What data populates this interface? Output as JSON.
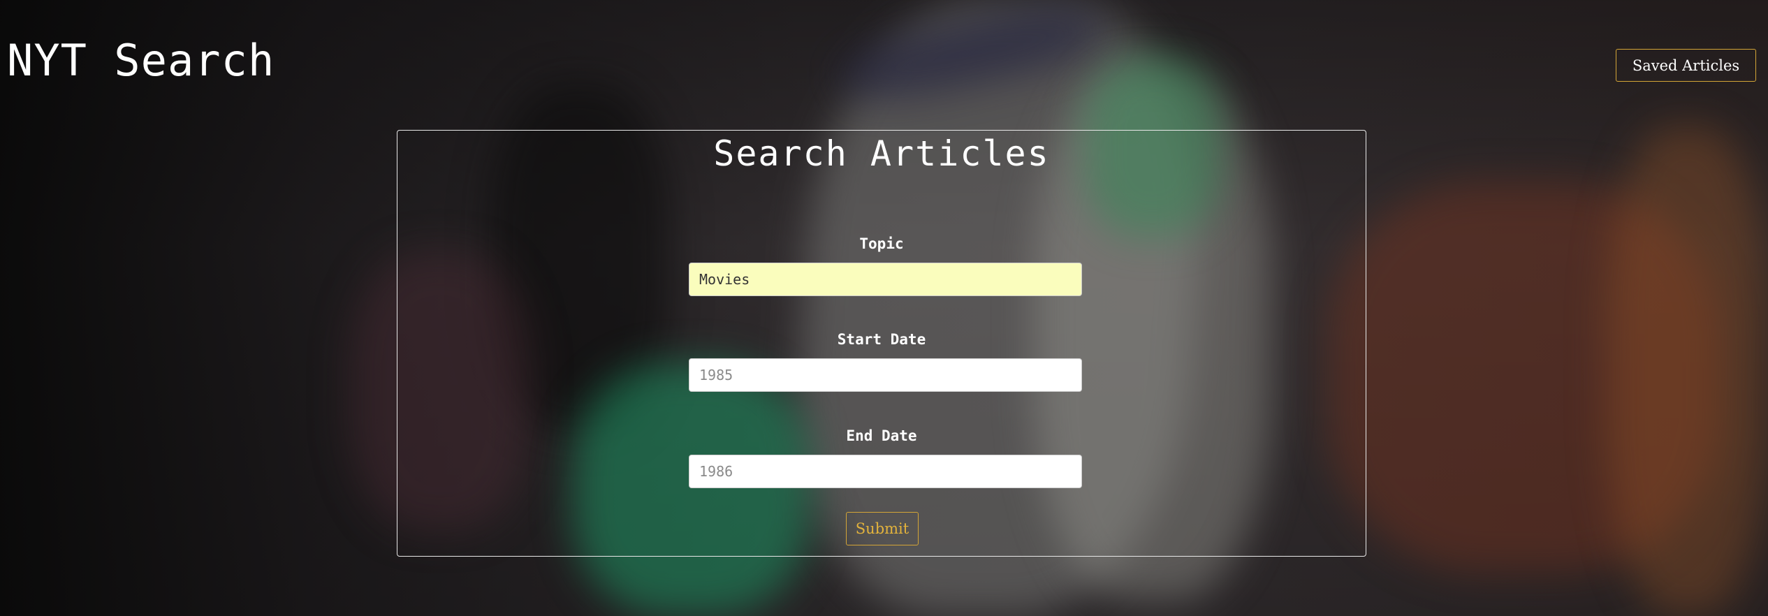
{
  "header": {
    "site_title": "NYT Search",
    "saved_articles_label": "Saved Articles"
  },
  "search": {
    "title": "Search Articles",
    "topic": {
      "label": "Topic",
      "value": "Movies",
      "placeholder": ""
    },
    "start_date": {
      "label": "Start Date",
      "value": "",
      "placeholder": "1985"
    },
    "end_date": {
      "label": "End Date",
      "value": "",
      "placeholder": "1986"
    },
    "submit_label": "Submit"
  },
  "colors": {
    "accent_gold": "#d4a537",
    "autofill_yellow": "#fafdbd",
    "panel_border": "#e8e8e8"
  }
}
